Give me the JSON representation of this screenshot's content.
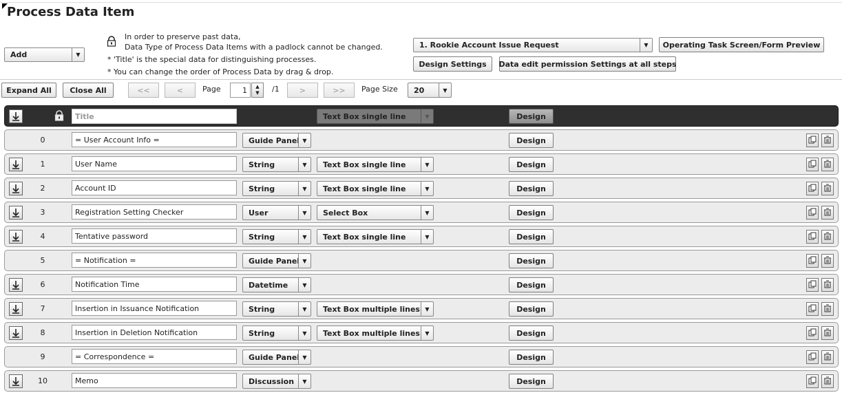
{
  "page_title": "Process Data Item",
  "add_select": "Add",
  "notes": {
    "line1": "In order to preserve past data,",
    "line2": "Data Type of Process Data Items with a padlock cannot be changed.",
    "line3": "* 'Title' is the special data for distinguishing processes.",
    "line4": "* You can change the order of Process Data by drag & drop."
  },
  "process_select": "1. Rookie Account Issue Request",
  "preview_button": "Operating Task Screen/Form Preview",
  "design_settings_button": "Design Settings",
  "permission_button": "Data edit permission Settings at all steps",
  "toolbar": {
    "expand_all": "Expand All",
    "close_all": "Close All",
    "first": "<<",
    "prev": "<",
    "page_label": "Page",
    "page_value": "1",
    "page_total": "/1",
    "next": ">",
    "last": ">>",
    "page_size_label": "Page Size",
    "page_size_value": "20"
  },
  "title_row": {
    "placeholder": "Title",
    "widget": "Text Box single line",
    "design": "Design"
  },
  "rows": [
    {
      "num": "0",
      "name": "= User Account Info =",
      "type": "Guide Panel",
      "widget": "",
      "design": "Design",
      "handle": false
    },
    {
      "num": "1",
      "name": "User Name",
      "type": "String",
      "widget": "Text Box single line",
      "design": "Design",
      "handle": true
    },
    {
      "num": "2",
      "name": "Account ID",
      "type": "String",
      "widget": "Text Box single line",
      "design": "Design",
      "handle": true
    },
    {
      "num": "3",
      "name": "Registration Setting Checker",
      "type": "User",
      "widget": "Select Box",
      "design": "Design",
      "handle": true
    },
    {
      "num": "4",
      "name": "Tentative password",
      "type": "String",
      "widget": "Text Box single line",
      "design": "Design",
      "handle": true
    },
    {
      "num": "5",
      "name": "= Notification =",
      "type": "Guide Panel",
      "widget": "",
      "design": "Design",
      "handle": false
    },
    {
      "num": "6",
      "name": "Notification Time",
      "type": "Datetime",
      "widget": "",
      "design": "Design",
      "handle": true
    },
    {
      "num": "7",
      "name": "Insertion in Issuance Notification",
      "type": "String",
      "widget": "Text Box multiple lines",
      "design": "Design",
      "handle": true
    },
    {
      "num": "8",
      "name": "Insertion in Deletion Notification",
      "type": "String",
      "widget": "Text Box multiple lines",
      "design": "Design",
      "handle": true
    },
    {
      "num": "9",
      "name": "= Correspondence =",
      "type": "Guide Panel",
      "widget": "",
      "design": "Design",
      "handle": false
    },
    {
      "num": "10",
      "name": "Memo",
      "type": "Discussion",
      "widget": "",
      "design": "Design",
      "handle": true
    }
  ]
}
